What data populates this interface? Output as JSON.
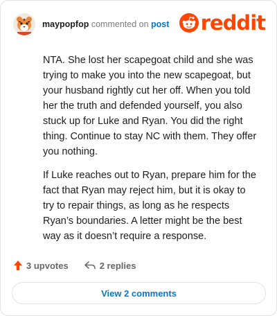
{
  "header": {
    "username": "maypopfop",
    "commented_on": "commented on",
    "post_link": "post"
  },
  "brand": {
    "wordmark": "reddit",
    "color": "#ff4500"
  },
  "comment": {
    "paragraphs": [
      "NTA. She lost her scapegoat child and she was trying to make you into the new scapegoat, but your husband rightly cut her off. When you told her the truth and defended yourself, you also stuck up for Luke and Ryan. You did the right thing. Continue to stay NC with them. They offer you nothing.",
      "If Luke reaches out to Ryan, prepare him for the fact that Ryan may reject him, but it is okay to try to repair things, as long as he respects Ryan’s boundaries. A letter might be the best way as it doesn’t require a response."
    ]
  },
  "actions": {
    "upvotes_label": "3 upvotes",
    "replies_label": "2 replies",
    "upvote_icon": "upvote-arrow-icon",
    "reply_icon": "reply-arrow-icon",
    "upvote_color": "#ff4500"
  },
  "footer": {
    "view_comments_label": "View 2 comments",
    "link_color": "#0079d3"
  }
}
